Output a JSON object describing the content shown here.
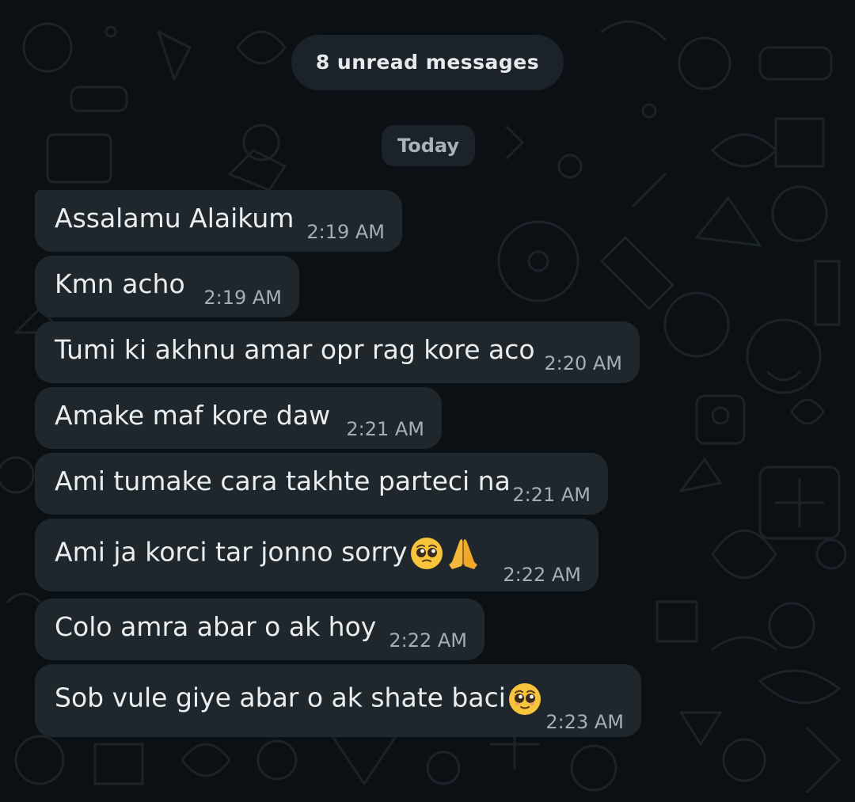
{
  "colors": {
    "background": "#0b1014",
    "bubble": "#1f272d",
    "pill": "#1b2229",
    "text": "#e9edef",
    "timestamp": "#a4afb5"
  },
  "unread_banner": {
    "label": "8 unread messages"
  },
  "date_separator": {
    "label": "Today"
  },
  "messages": [
    {
      "text": "Assalamu Alaikum",
      "time": "2:19 AM"
    },
    {
      "text": "Kmn acho",
      "time": "2:19 AM"
    },
    {
      "text": "Tumi ki akhnu amar opr rag kore aco",
      "time": "2:20 AM"
    },
    {
      "text": "Amake maf kore daw",
      "time": "2:21 AM"
    },
    {
      "text": "Ami tumake cara takhte parteci na",
      "time": "2:21 AM"
    },
    {
      "text": "Ami ja korci tar jonno sorry",
      "time": "2:22 AM",
      "emojis": [
        "pleading-face-emoji",
        "folded-hands-emoji"
      ]
    },
    {
      "text": "Colo amra abar o ak hoy",
      "time": "2:22 AM"
    },
    {
      "text": "Sob vule giye abar o ak shate baci",
      "time": "2:23 AM",
      "emojis": [
        "pleading-face-emoji"
      ]
    }
  ]
}
